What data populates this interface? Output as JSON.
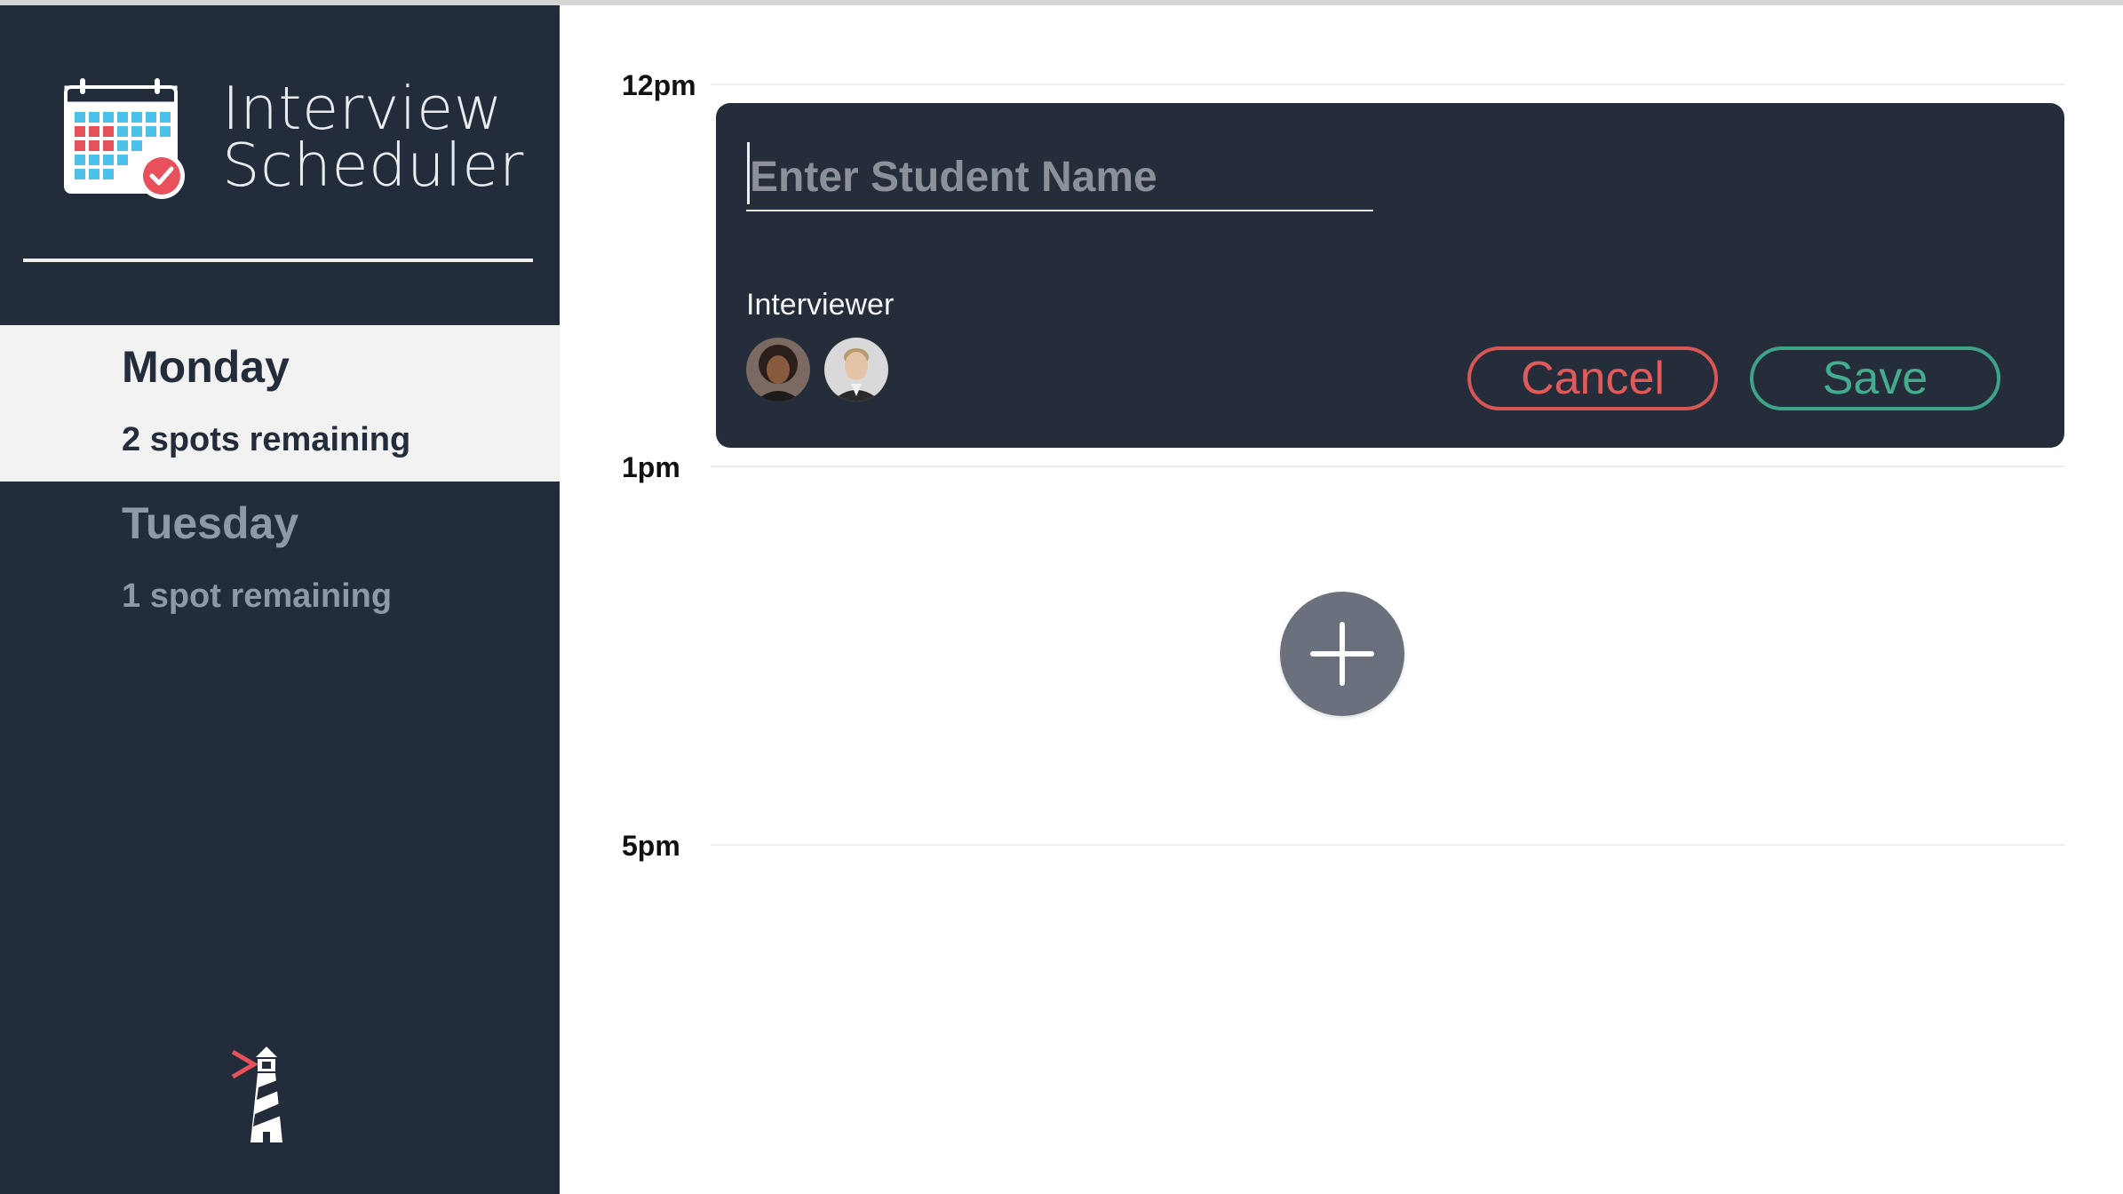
{
  "app": {
    "title_line1": "Interview",
    "title_line2": "Scheduler",
    "logo_icon": "calendar-check-icon",
    "footer_logo_icon": "lighthouse-icon"
  },
  "days": [
    {
      "name": "Monday",
      "spots": "2 spots remaining",
      "selected": true
    },
    {
      "name": "Tuesday",
      "spots": "1 spot remaining",
      "selected": false
    }
  ],
  "schedule": {
    "times": [
      "12pm",
      "1pm",
      "5pm"
    ]
  },
  "form": {
    "student_placeholder": "Enter Student Name",
    "student_value": "",
    "interviewer_label": "Interviewer",
    "cancel_label": "Cancel",
    "save_label": "Save",
    "interviewers": [
      {
        "icon": "interviewer-avatar-woman"
      },
      {
        "icon": "interviewer-avatar-man"
      }
    ]
  },
  "add_button": {
    "icon": "plus-icon"
  },
  "colors": {
    "sidebar": "#222c3b",
    "form_bg": "#252d3b",
    "cancel": "#d85656",
    "save": "#3ea388",
    "add_button": "#6b717c",
    "selected_day_bg": "#f2f2f2"
  }
}
